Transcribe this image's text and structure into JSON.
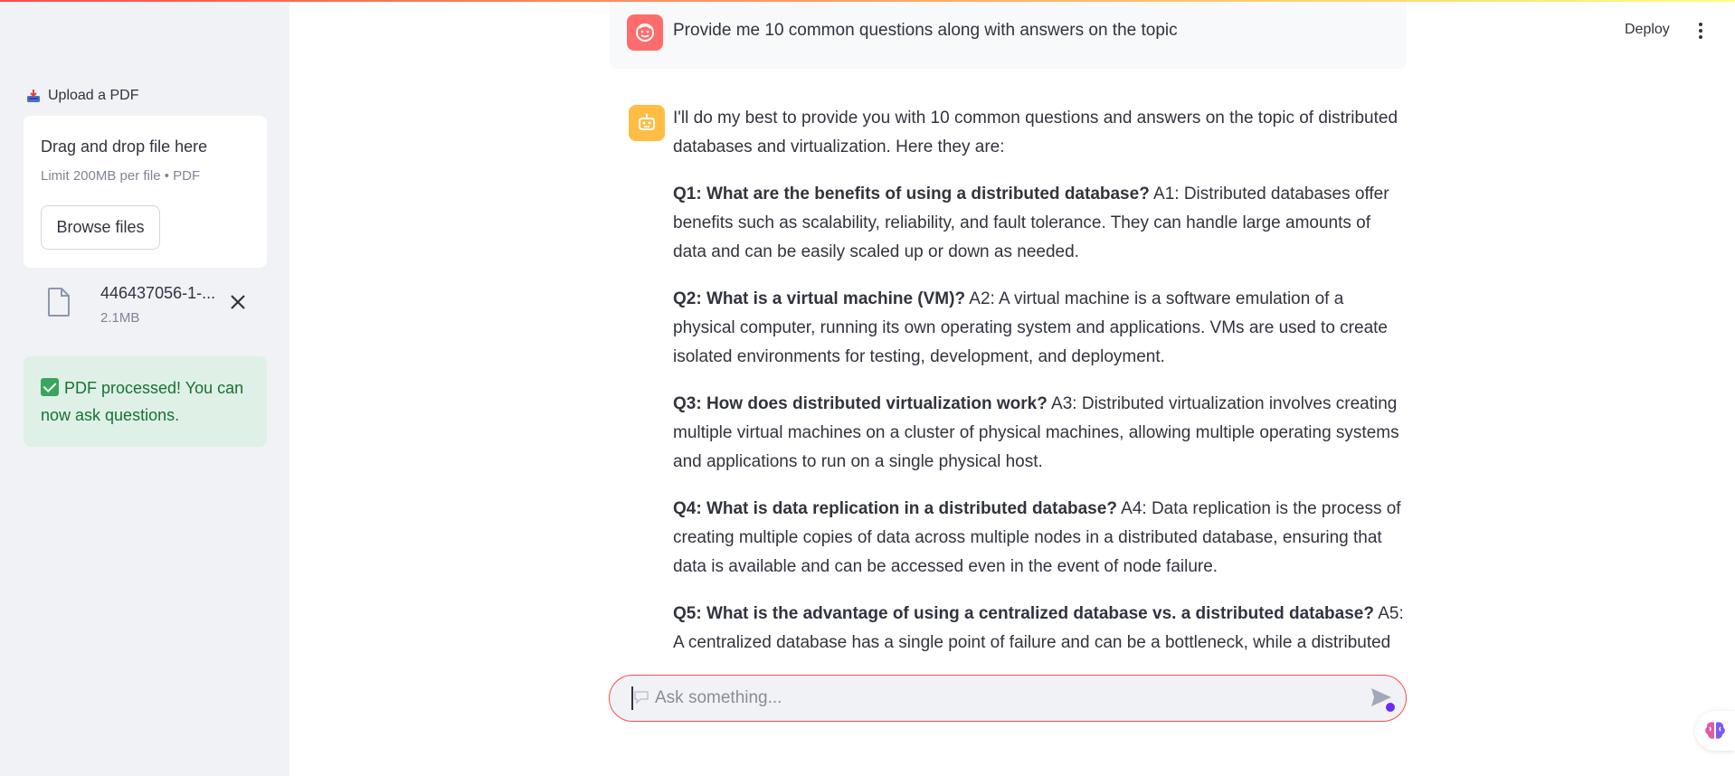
{
  "sidebar": {
    "upload_label": "Upload a PDF",
    "dropzone_title": "Drag and drop file here",
    "dropzone_limit": "Limit 200MB per file • PDF",
    "browse_label": "Browse files",
    "file": {
      "name": "446437056-1-...",
      "size": "2.1MB"
    },
    "success_text": "PDF processed! You can now ask questions."
  },
  "header": {
    "deploy_label": "Deploy"
  },
  "chat": {
    "user_message": "Provide me 10 common questions along with answers on the topic",
    "assistant_intro": "I'll do my best to provide you with 10 common questions and answers on the topic of distributed databases and virtualization. Here they are:",
    "qa": [
      {
        "q": "Q1: What are the benefits of using a distributed database?",
        "a": " A1: Distributed databases offer benefits such as scalability, reliability, and fault tolerance. They can handle large amounts of data and can be easily scaled up or down as needed."
      },
      {
        "q": "Q2: What is a virtual machine (VM)?",
        "a": " A2: A virtual machine is a software emulation of a physical computer, running its own operating system and applications. VMs are used to create isolated environments for testing, development, and deployment."
      },
      {
        "q": "Q3: How does distributed virtualization work?",
        "a": " A3: Distributed virtualization involves creating multiple virtual machines on a cluster of physical machines, allowing multiple operating systems and applications to run on a single physical host."
      },
      {
        "q": "Q4: What is data replication in a distributed database?",
        "a": " A4: Data replication is the process of creating multiple copies of data across multiple nodes in a distributed database, ensuring that data is available and can be accessed even in the event of node failure."
      },
      {
        "q": "Q5: What is the advantage of using a centralized database vs. a distributed database?",
        "a": " A5: A centralized database has a single point of failure and can be a bottleneck, while a distributed"
      }
    ]
  },
  "input": {
    "placeholder": "Ask something..."
  },
  "colors": {
    "accent": "#ff4b4b",
    "user_avatar": "#ff6c6c",
    "bot_avatar": "#ffbd45",
    "success_bg": "#dff0e7",
    "success_text": "#177233",
    "sidebar_bg": "#f0f2f6"
  },
  "icons": {
    "upload": "inbox-tray-icon",
    "file": "file-icon",
    "close": "close-icon",
    "check": "check-icon",
    "user": "face-icon",
    "bot": "robot-icon",
    "send": "send-icon",
    "menu": "vertical-dots-icon",
    "brain": "brain-icon"
  }
}
